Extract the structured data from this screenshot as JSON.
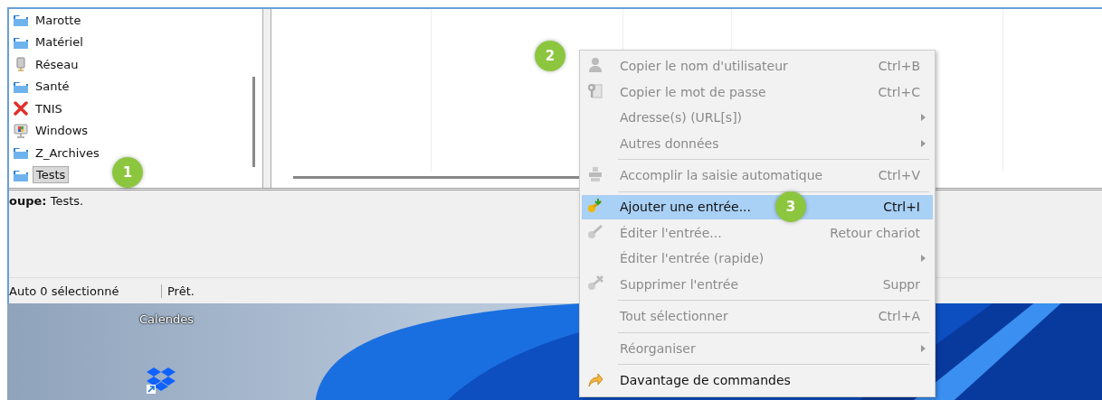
{
  "groups_tree": {
    "items": [
      {
        "label": "Marotte",
        "selected": false
      },
      {
        "label": "Matériel",
        "selected": false
      },
      {
        "label": "Réseau",
        "selected": false
      },
      {
        "label": "Santé",
        "selected": false
      },
      {
        "label": "TNIS",
        "selected": false
      },
      {
        "label": "Windows",
        "selected": false
      },
      {
        "label": "Z_Archives",
        "selected": false
      },
      {
        "label": "Tests",
        "selected": true
      }
    ]
  },
  "details": {
    "text": "**oupe:** Tests."
  },
  "status_bar": [
    "Auto 0 sélectionné",
    "Prêt."
  ],
  "desktop": {
    "icon_label": "Calendes"
  },
  "context_menu": {
    "items": [
      {
        "kind": "item",
        "label": "Copier le nom d'utilisateur",
        "shortcut": "Ctrl+B",
        "disabled": true,
        "selected": false,
        "submenu": false
      },
      {
        "kind": "item",
        "label": "Copier le mot de passe",
        "shortcut": "Ctrl+C",
        "disabled": true,
        "selected": false,
        "submenu": false
      },
      {
        "kind": "item",
        "label": "Adresse(s) (URL[s])",
        "disabled": true,
        "selected": false,
        "submenu": true
      },
      {
        "kind": "item",
        "label": "Autres données",
        "disabled": true,
        "selected": false,
        "submenu": true
      },
      {
        "kind": "separator"
      },
      {
        "kind": "item",
        "label": "Accomplir la saisie automatique",
        "shortcut": "Ctrl+V",
        "disabled": true,
        "selected": false,
        "submenu": false
      },
      {
        "kind": "separator"
      },
      {
        "kind": "item",
        "label": "Ajouter une entrée...",
        "shortcut": "Ctrl+I",
        "disabled": false,
        "selected": true,
        "submenu": false
      },
      {
        "kind": "item",
        "label": "Éditer l'entrée...",
        "shortcut": "Retour chariot",
        "disabled": true,
        "selected": false,
        "submenu": false
      },
      {
        "kind": "item",
        "label": "Éditer l'entrée (rapide)",
        "disabled": true,
        "selected": false,
        "submenu": true
      },
      {
        "kind": "item",
        "label": "Supprimer l'entrée",
        "shortcut": "Suppr",
        "disabled": true,
        "selected": false,
        "submenu": false
      },
      {
        "kind": "separator"
      },
      {
        "kind": "item",
        "label": "Tout sélectionner",
        "shortcut": "Ctrl+A",
        "disabled": true,
        "selected": false,
        "submenu": false
      },
      {
        "kind": "separator"
      },
      {
        "kind": "item",
        "label": "Réorganiser",
        "disabled": true,
        "selected": false,
        "submenu": true
      },
      {
        "kind": "separator"
      },
      {
        "kind": "item",
        "label": "Davantage de commandes",
        "disabled": false,
        "selected": false,
        "submenu": false
      }
    ]
  },
  "step_badges": [
    "1",
    "2",
    "3"
  ]
}
